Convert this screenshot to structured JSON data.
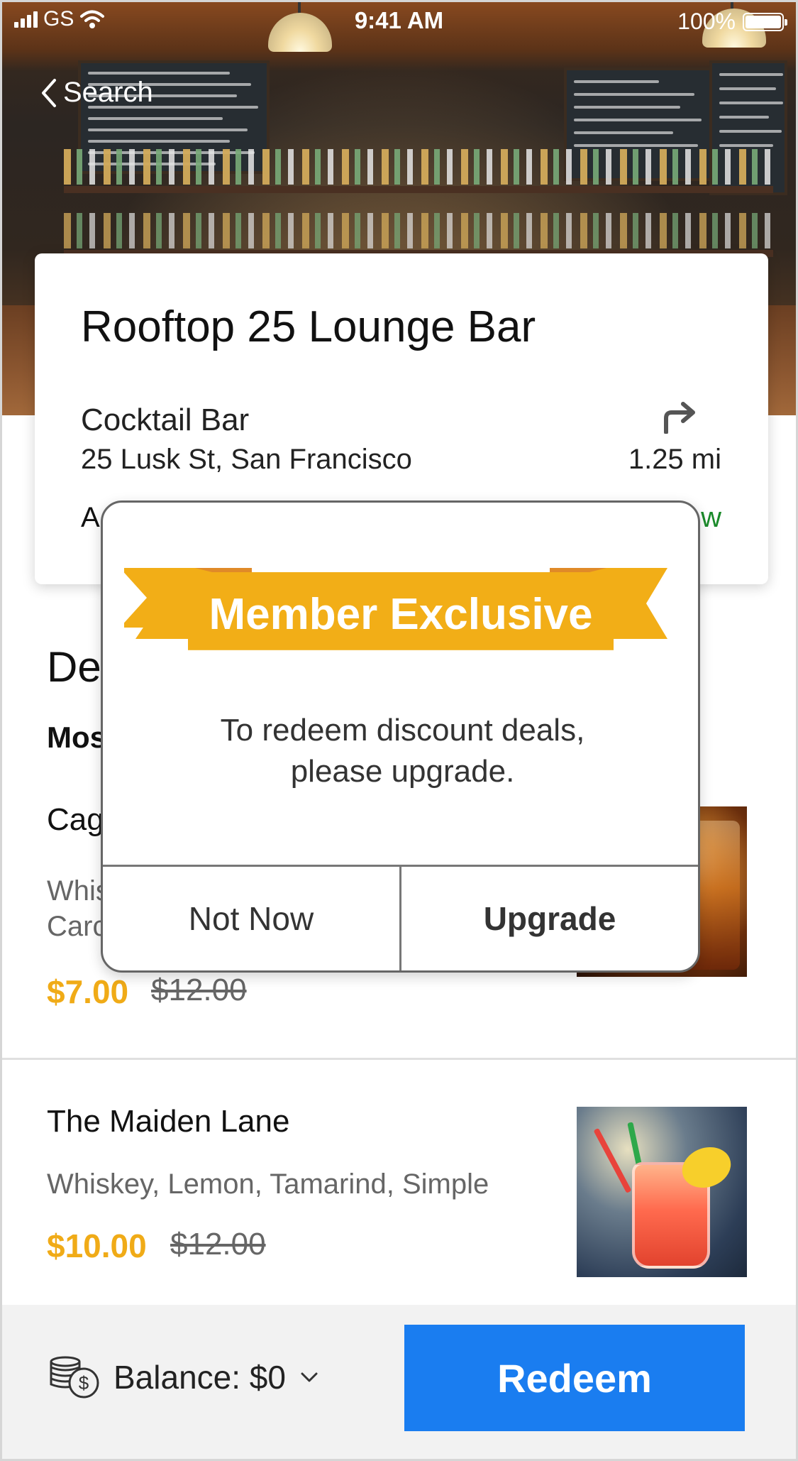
{
  "status_bar": {
    "carrier": "GS",
    "time": "9:41 AM",
    "battery": "100%"
  },
  "nav": {
    "back_label": "Search"
  },
  "venue": {
    "name": "Rooftop 25 Lounge Bar",
    "type": "Cocktail Bar",
    "address": "25 Lusk St, San Francisco",
    "distance": "1.25 mi",
    "row_left_fragment": "A",
    "row_right_fragment": "w"
  },
  "deals": {
    "title_fragment": "De",
    "subtitle_fragment": "Mos",
    "items": [
      {
        "name": "Cag",
        "description": "Whis\nCarc",
        "price": "$7.00",
        "old_price": "$12.00",
        "image": "whiskey-glass-image"
      },
      {
        "name": "The Maiden Lane",
        "description": "Whiskey, Lemon, Tamarind, Simple",
        "price": "$10.00",
        "old_price": "$12.00",
        "image": "cocktail-jar-image"
      }
    ]
  },
  "bottom_bar": {
    "balance": "Balance: $0",
    "redeem_label": "Redeem"
  },
  "modal": {
    "ribbon_title": "Member Exclusive",
    "message": "To redeem discount deals,\nplease upgrade.",
    "secondary_label": "Not Now",
    "primary_label": "Upgrade"
  },
  "colors": {
    "accent_blue": "#1a7df0",
    "price_orange": "#f0ab17",
    "ribbon_gold": "#f2ae17",
    "ribbon_dark": "#e08a28",
    "open_green": "#1a8a2a"
  },
  "icons": {
    "back": "chevron-left-icon",
    "directions": "turn-right-arrow-icon",
    "balance": "coins-icon",
    "balance_toggle": "chevron-down-icon"
  }
}
